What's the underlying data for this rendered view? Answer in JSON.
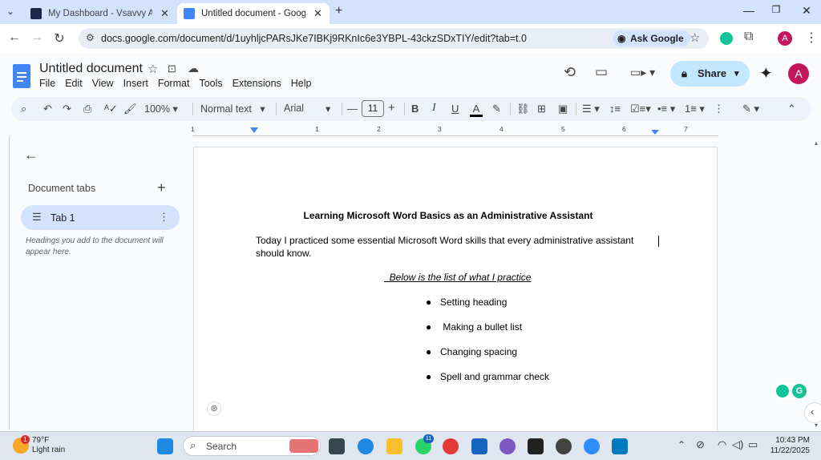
{
  "browser": {
    "tabs": [
      {
        "title": "My Dashboard - Vsavvy Academ",
        "active": false
      },
      {
        "title": "Untitled document - Google Do",
        "active": true
      }
    ],
    "url": "docs.google.com/document/d/1uyhljcPARsJKe7IBKj9RKnIc6e3YBPL-43ckzSDxTIY/edit?tab=t.0",
    "ask_google": "Ask Google",
    "profile_initial": "A"
  },
  "docs": {
    "title": "Untitled document",
    "menu": [
      "File",
      "Edit",
      "View",
      "Insert",
      "Format",
      "Tools",
      "Extensions",
      "Help"
    ],
    "share_label": "Share",
    "avatar_initial": "A"
  },
  "toolbar": {
    "zoom": "100%",
    "style": "Normal text",
    "font": "Arial",
    "font_size": "11"
  },
  "ruler": {
    "labels": [
      "1",
      "1",
      "2",
      "3",
      "4",
      "5",
      "6",
      "7"
    ]
  },
  "sidebar": {
    "section_title": "Document tabs",
    "tab_label": "Tab 1",
    "hint": "Headings you add to the document will appear here."
  },
  "document": {
    "heading": "Learning Microsoft Word Basics as an Administrative Assistant",
    "paragraph": "Today I practiced some essential Microsoft Word skills that every administrative assistant should know.",
    "list_title": "  Below is the list of what I practice",
    "bullets": [
      "Setting heading",
      " Making a bullet list",
      "Changing spacing",
      "Spell and grammar check"
    ]
  },
  "taskbar": {
    "weather_temp": "79°F",
    "weather_desc": "Light rain",
    "weather_badge": "1",
    "search_label": "Search",
    "whatsapp_badge": "11",
    "time": "10:43 PM",
    "date": "11/22/2025"
  },
  "colors": {
    "tab_strip": "#d3e3fd",
    "share_bg": "#c2e7ff",
    "avatar": "#c2185b",
    "docs_blue": "#4285f4"
  }
}
